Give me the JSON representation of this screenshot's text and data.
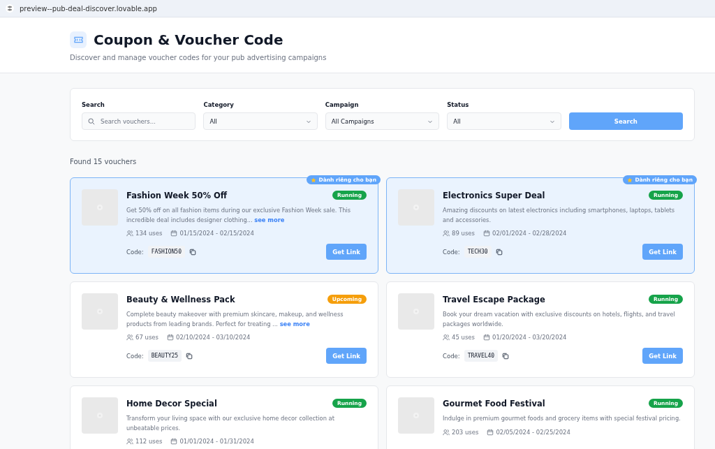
{
  "browser": {
    "url": "preview--pub-deal-discover.lovable.app"
  },
  "header": {
    "title": "Coupon & Voucher Code",
    "subtitle": "Discover and manage voucher codes for your pub advertising campaigns"
  },
  "filters": {
    "fields": [
      {
        "kind": "search",
        "label": "Search",
        "placeholder": "Search vouchers..."
      },
      {
        "kind": "select",
        "label": "Category",
        "value": "All"
      },
      {
        "kind": "select",
        "label": "Campaign",
        "value": "All Campaigns"
      },
      {
        "kind": "select",
        "label": "Status",
        "value": "All"
      }
    ],
    "button": "Search"
  },
  "result_count": "Found 15 vouchers",
  "vouchers": [
    {
      "title": "Fashion Week 50% Off",
      "featured": true,
      "badge": "Dành riêng cho bạn",
      "status": "Running",
      "color": "#16a34a",
      "description": "Get 50% off on all fashion items during our exclusive Fashion Week sale. This incredible deal includes designer clothing...",
      "more_link": "see more",
      "uses": "134 uses",
      "dates": "01/15/2024 - 02/15/2024",
      "code_label": "Code:",
      "code": "FASHION50",
      "button": "Get Link"
    },
    {
      "title": "Electronics Super Deal",
      "featured": true,
      "badge": "Dành riêng cho bạn",
      "status": "Running",
      "color": "#16a34a",
      "description": "Amazing discounts on latest electronics including smartphones, laptops, tablets and accessories.",
      "uses": "89 uses",
      "dates": "02/01/2024 - 02/28/2024",
      "code_label": "Code:",
      "code": "TECH30",
      "button": "Get Link"
    },
    {
      "title": "Beauty & Wellness Pack",
      "featured": false,
      "status": "Upcoming",
      "color": "#f59e0b",
      "description": "Complete beauty makeover with premium skincare, makeup, and wellness products from leading brands. Perfect for treating ...",
      "more_link": "see more",
      "uses": "67 uses",
      "dates": "02/10/2024 - 03/10/2024",
      "code_label": "Code:",
      "code": "BEAUTY25",
      "button": "Get Link"
    },
    {
      "title": "Travel Escape Package",
      "featured": false,
      "status": "Running",
      "color": "#16a34a",
      "description": "Book your dream vacation with exclusive discounts on hotels, flights, and travel packages worldwide.",
      "uses": "45 uses",
      "dates": "01/20/2024 - 03/20/2024",
      "code_label": "Code:",
      "code": "TRAVEL40",
      "button": "Get Link"
    },
    {
      "title": "Home Decor Special",
      "featured": false,
      "status": "Running",
      "color": "#16a34a",
      "description": "Transform your living space with our exclusive home decor collection at unbeatable prices.",
      "uses": "112 uses",
      "dates": "01/01/2024 - 01/31/2024"
    },
    {
      "title": "Gourmet Food Festival",
      "featured": false,
      "status": "Running",
      "color": "#16a34a",
      "description": "Indulge in premium gourmet foods and grocery items with special festival pricing.",
      "uses": "203 uses",
      "dates": "02/05/2024 - 02/25/2024"
    }
  ]
}
